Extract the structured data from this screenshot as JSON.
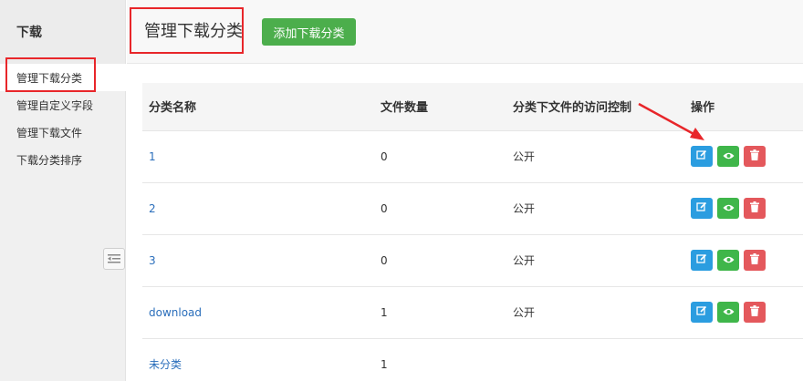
{
  "sidebar": {
    "title": "下载",
    "items": [
      {
        "label": "管理下载分类"
      },
      {
        "label": "管理自定义字段"
      },
      {
        "label": "管理下载文件"
      },
      {
        "label": "下载分类排序"
      }
    ]
  },
  "header": {
    "title": "管理下载分类",
    "add_button": "添加下载分类"
  },
  "table": {
    "headers": [
      "分类名称",
      "文件数量",
      "分类下文件的访问控制",
      "操作"
    ],
    "rows": [
      {
        "name": "1",
        "count": "0",
        "access": "公开"
      },
      {
        "name": "2",
        "count": "0",
        "access": "公开"
      },
      {
        "name": "3",
        "count": "0",
        "access": "公开"
      },
      {
        "name": "download",
        "count": "1",
        "access": "公开"
      },
      {
        "name": "未分类",
        "count": "1",
        "access": ""
      }
    ]
  },
  "colors": {
    "add_button": "#4cae4c",
    "edit_button": "#2b9de0",
    "view_button": "#3fb64a",
    "delete_button": "#e4585c",
    "link": "#2a6ebb",
    "annotation": "#e8262a"
  },
  "icons": {
    "edit": "edit-icon",
    "view": "eye-icon",
    "delete": "trash-icon",
    "collapse": "collapse-sidebar-icon"
  }
}
